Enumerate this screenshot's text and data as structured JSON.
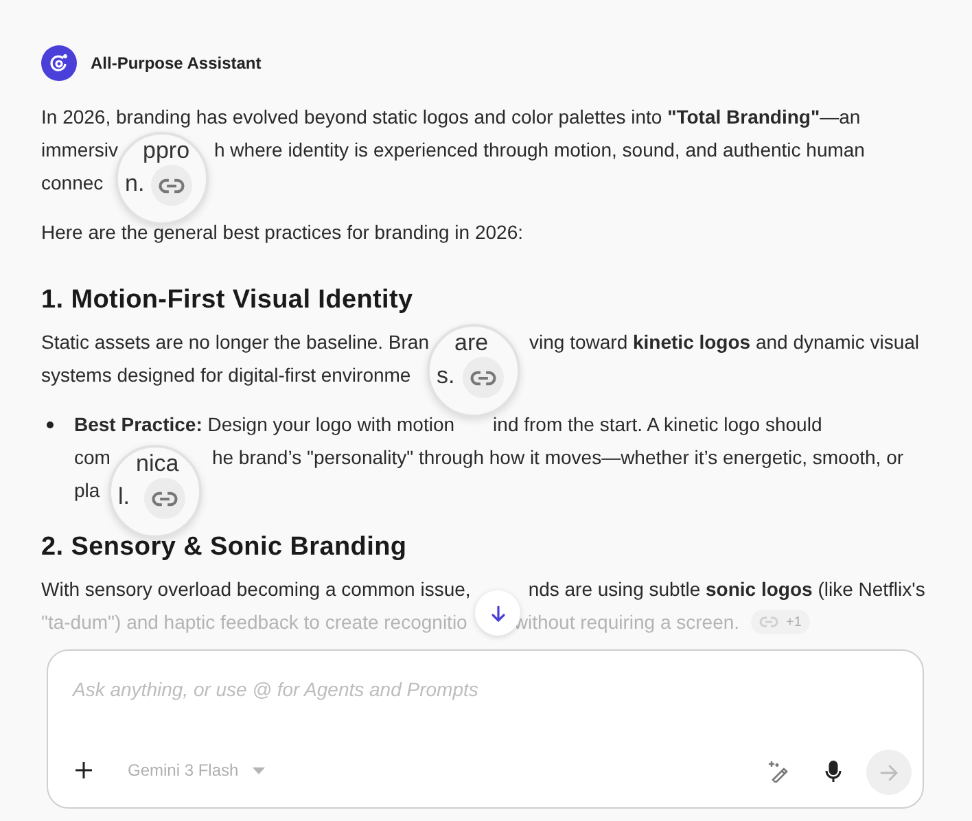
{
  "message": {
    "author": "All-Purpose Assistant",
    "blocks": [
      {
        "kind": "paragraph",
        "lines": [
          [
            "In 2026, branding has evolved beyond static logos and color palettes into **\"Total Branding\"**—an"
          ],
          [
            "immersiv",
            "h where identity is experienced through motion, sound, and authentic human"
          ],
          [
            "connec"
          ]
        ]
      },
      {
        "kind": "paragraph",
        "lines": [
          [
            "Here are the general best practices for branding in 2026:"
          ]
        ]
      },
      {
        "kind": "heading",
        "text": "1. Motion-First Visual Identity"
      },
      {
        "kind": "paragraph",
        "lines": [
          [
            "Static assets are no longer the baseline. Bran",
            "ving toward **kinetic logos** and dynamic visual"
          ],
          [
            "systems designed for digital-first environme"
          ]
        ]
      },
      {
        "kind": "bullet",
        "lines": [
          [
            "**Best Practice:** Design your logo with motion",
            "ind from the start. A kinetic logo should"
          ],
          [
            "com",
            "he brand’s \"personality\" through how it moves—whether it’s energetic, smooth, or"
          ],
          [
            "pla"
          ]
        ]
      },
      {
        "kind": "heading",
        "text": "2. Sensory & Sonic Branding"
      },
      {
        "kind": "paragraph",
        "lines": [
          [
            "With sensory overload becoming a common issue,",
            "nds are using subtle **sonic logos** (like Netflix's"
          ]
        ]
      },
      {
        "kind": "faded",
        "lines": [
          [
            "\"ta-dum\") and haptic feedback to create recognitio",
            "without requiring a screen."
          ]
        ],
        "source_count": "+1"
      }
    ]
  },
  "magnifiers": [
    {
      "top_text": "ppro",
      "side_text": "n."
    },
    {
      "top_text": "are",
      "side_text": "s."
    },
    {
      "top_text": "nica",
      "side_text": "l."
    }
  ],
  "composer": {
    "placeholder": "Ask anything, or use @ for Agents and Prompts",
    "model": "Gemini 3 Flash"
  }
}
